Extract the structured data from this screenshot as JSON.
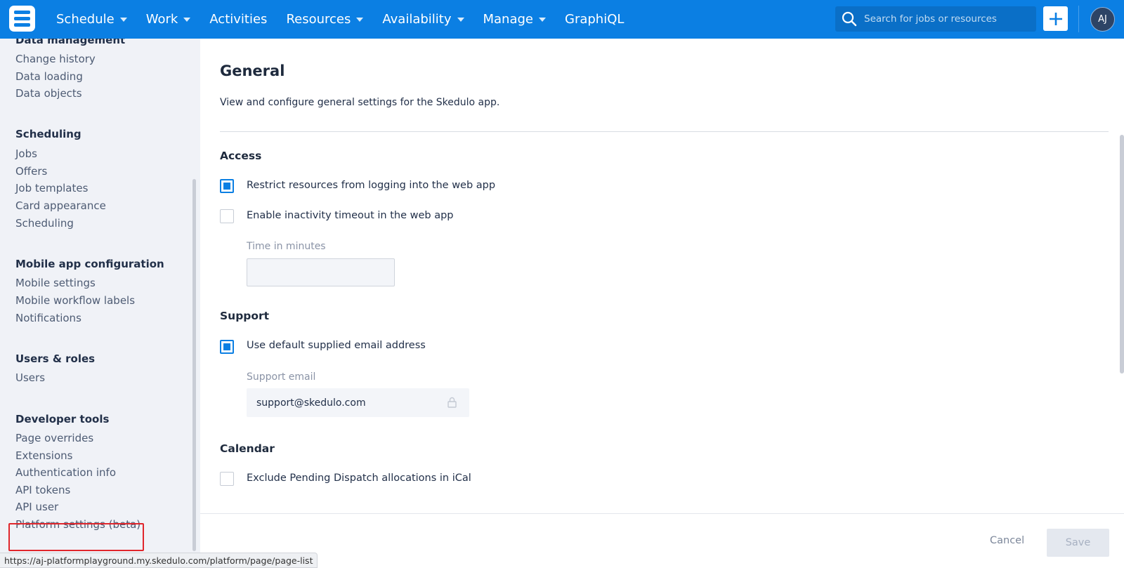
{
  "topbar": {
    "nav": [
      {
        "label": "Schedule",
        "dropdown": true
      },
      {
        "label": "Work",
        "dropdown": true
      },
      {
        "label": "Activities",
        "dropdown": false
      },
      {
        "label": "Resources",
        "dropdown": true
      },
      {
        "label": "Availability",
        "dropdown": true
      },
      {
        "label": "Manage",
        "dropdown": true
      },
      {
        "label": "GraphiQL",
        "dropdown": false
      }
    ],
    "search_placeholder": "Search for jobs or resources",
    "avatar_initials": "AJ"
  },
  "sidebar": {
    "sections": [
      {
        "title": "Data management",
        "items": [
          "Change history",
          "Data loading",
          "Data objects"
        ]
      },
      {
        "title": "Scheduling",
        "items": [
          "Jobs",
          "Offers",
          "Job templates",
          "Card appearance",
          "Scheduling"
        ]
      },
      {
        "title": "Mobile app configuration",
        "items": [
          "Mobile settings",
          "Mobile workflow labels",
          "Notifications"
        ]
      },
      {
        "title": "Users & roles",
        "items": [
          "Users"
        ]
      },
      {
        "title": "Developer tools",
        "items": [
          "Page overrides",
          "Extensions",
          "Authentication info",
          "API tokens",
          "API user",
          "Platform settings (beta)"
        ]
      }
    ]
  },
  "main": {
    "title": "General",
    "description": "View and configure general settings for the Skedulo app.",
    "access": {
      "heading": "Access",
      "restrict_label": "Restrict resources from logging into the web app",
      "restrict_checked": true,
      "inactivity_label": "Enable inactivity timeout in the web app",
      "inactivity_checked": false,
      "time_label": "Time in minutes",
      "time_value": ""
    },
    "support": {
      "heading": "Support",
      "default_email_label": "Use default supplied email address",
      "default_email_checked": true,
      "email_label": "Support email",
      "email_value": "support@skedulo.com"
    },
    "calendar": {
      "heading": "Calendar",
      "exclude_label": "Exclude Pending Dispatch allocations in iCal",
      "exclude_checked": false
    }
  },
  "footer": {
    "cancel_label": "Cancel",
    "save_label": "Save"
  },
  "status_bar": {
    "url": "https://aj-platformplayground.my.skedulo.com/platform/page/page-list"
  },
  "colors": {
    "brand_blue": "#0b7fe3",
    "highlight_red": "#e0262c"
  }
}
